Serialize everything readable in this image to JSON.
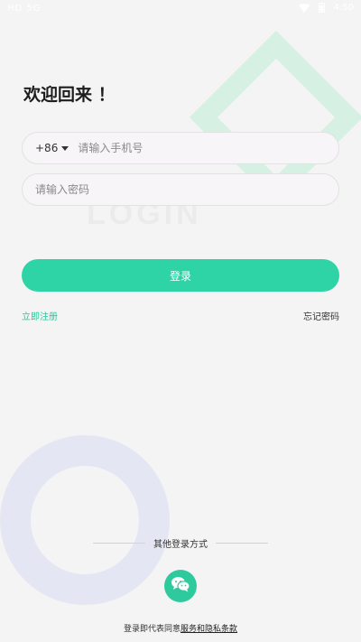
{
  "status_bar": {
    "carrier": "HD 5G",
    "time": "4:50",
    "icons": [
      "wifi-icon",
      "battery-icon"
    ]
  },
  "decor": {
    "watermark": "LOGIN"
  },
  "welcome": "欢迎回来 ！",
  "phone_field": {
    "country_code": "+86",
    "placeholder": "请输入手机号",
    "value": ""
  },
  "password_field": {
    "placeholder": "请输入密码",
    "value": ""
  },
  "login_button": "登录",
  "register_link": "立即注册",
  "forgot_link": "忘记密码",
  "other_login": {
    "label": "其他登录方式",
    "wechat_icon": "wechat-icon"
  },
  "agreement": {
    "prefix": "登录即代表同意",
    "terms": "服务和隐私条款"
  },
  "colors": {
    "accent": "#2ed3a6",
    "background": "#f4f4f4",
    "field_bg": "#f7f5f7"
  }
}
